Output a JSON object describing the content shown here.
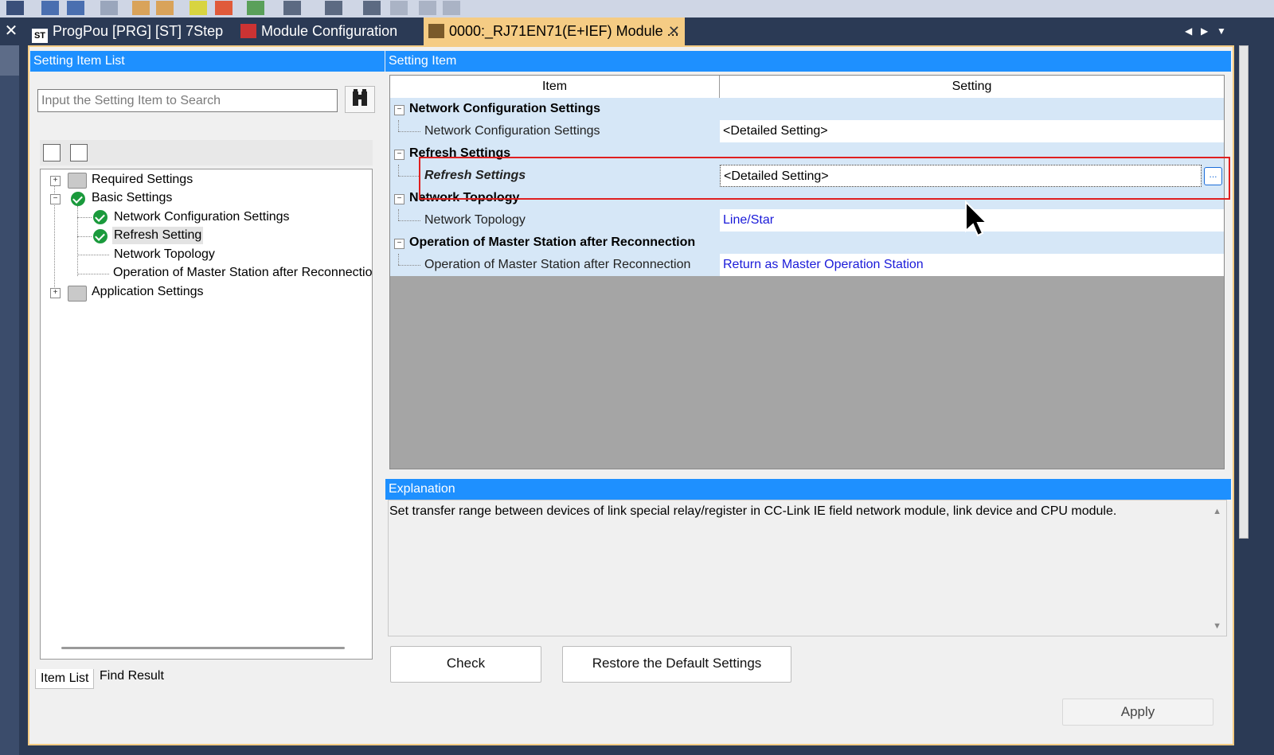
{
  "tabs": [
    {
      "label": "ProgPou [PRG] [ST] 7Step",
      "icon": "st-icon"
    },
    {
      "label": "Module Configuration",
      "icon": "module-config-icon"
    },
    {
      "label": "0000:_RJ71EN71(E+IEF) Module ...",
      "icon": "module-parameter-icon",
      "active": true
    }
  ],
  "left_panel": {
    "title": "Setting Item List",
    "search_placeholder": "Input the Setting Item to Search",
    "tree": {
      "required": "Required Settings",
      "basic": "Basic Settings",
      "basic_children": [
        "Network Configuration Settings",
        "Refresh Setting",
        "Network Topology",
        "Operation of Master Station after Reconnection"
      ],
      "application": "Application Settings"
    },
    "bottom_tabs": [
      "Item List",
      "Find Result"
    ]
  },
  "right_panel": {
    "title": "Setting Item",
    "columns": [
      "Item",
      "Setting"
    ],
    "rows": [
      {
        "kind": "category",
        "item": "Network Configuration Settings",
        "setting": ""
      },
      {
        "kind": "item",
        "item": "Network Configuration Settings",
        "setting": "<Detailed Setting>"
      },
      {
        "kind": "category",
        "item": "Refresh Settings",
        "setting": ""
      },
      {
        "kind": "item",
        "item": "Refresh Settings",
        "setting": "<Detailed Setting>"
      },
      {
        "kind": "category",
        "item": "Network Topology",
        "setting": ""
      },
      {
        "kind": "item",
        "item": "Network Topology",
        "setting": "Line/Star"
      },
      {
        "kind": "category",
        "item": "Operation of Master Station after Reconnection",
        "setting": ""
      },
      {
        "kind": "item",
        "item": "Operation of Master Station after Reconnection",
        "setting": "Return as Master Operation Station"
      }
    ],
    "ellipsis_button": "..."
  },
  "explanation": {
    "title": "Explanation",
    "text": "Set transfer range between devices of link special relay/register in CC-Link IE field network module, link device and CPU module."
  },
  "buttons": {
    "check": "Check",
    "restore": "Restore the Default Settings",
    "apply": "Apply"
  },
  "colors": {
    "header_blue": "#1e90ff",
    "active_tab": "#f5cc84",
    "highlight_red": "#e02020",
    "link_blue": "#1a1ad9"
  }
}
